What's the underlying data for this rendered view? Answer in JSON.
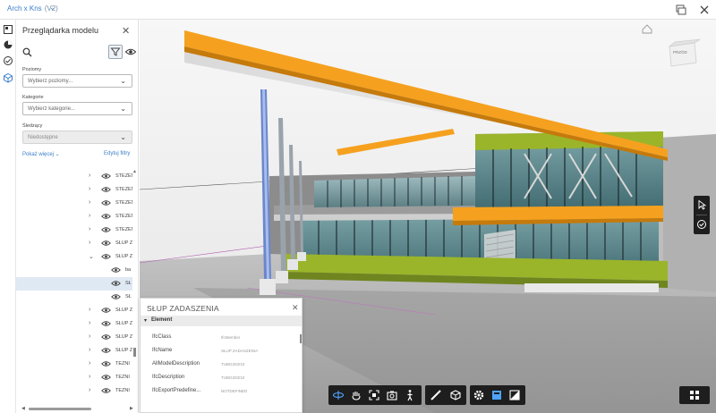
{
  "titlebar": {
    "document": "Arch x Kns",
    "version": "(V2)"
  },
  "panel": {
    "title": "Przeglądarka modelu",
    "filters": [
      {
        "label": "Poziomy",
        "value": "Wybierz poziomy...",
        "disabled": false
      },
      {
        "label": "Kategorie",
        "value": "Wybierz kategorie...",
        "disabled": false
      },
      {
        "label": "Śledzący",
        "value": "Niedostępne",
        "disabled": true
      }
    ],
    "show_more": "Pokaż więcej",
    "edit_filters": "Edytuj filtry",
    "tree": [
      {
        "label": "STEŻEN",
        "indent": 0,
        "arrow": "›"
      },
      {
        "label": "STEŻEN",
        "indent": 0,
        "arrow": "›"
      },
      {
        "label": "STEŻEN",
        "indent": 0,
        "arrow": "›"
      },
      {
        "label": "STEŻEN",
        "indent": 0,
        "arrow": "›"
      },
      {
        "label": "STEŻEN",
        "indent": 0,
        "arrow": "›"
      },
      {
        "label": "SŁUP Z",
        "indent": 0,
        "arrow": "›"
      },
      {
        "label": "SŁUP Z",
        "indent": 0,
        "arrow": "⌄"
      },
      {
        "label": "ba",
        "indent": 1,
        "arrow": ""
      },
      {
        "label": "SŁ",
        "indent": 1,
        "arrow": "",
        "selected": true
      },
      {
        "label": "SŁ",
        "indent": 1,
        "arrow": ""
      },
      {
        "label": "SŁUP Z",
        "indent": 0,
        "arrow": "›"
      },
      {
        "label": "SŁUP Z",
        "indent": 0,
        "arrow": "›"
      },
      {
        "label": "SŁUP Z",
        "indent": 0,
        "arrow": "›"
      },
      {
        "label": "SŁUP Z",
        "indent": 0,
        "arrow": "›"
      },
      {
        "label": "TEZNI",
        "indent": 0,
        "arrow": "›"
      },
      {
        "label": "TEZNI",
        "indent": 0,
        "arrow": "›"
      },
      {
        "label": "TEZNI",
        "indent": 0,
        "arrow": "›"
      }
    ]
  },
  "properties": {
    "title": "SŁUP ZADASZENIA",
    "section": "Element",
    "rows": [
      {
        "key": "IfcClass",
        "value": "IfcMember"
      },
      {
        "key": "IfcName",
        "value": "SŁUP ZADASZENIA"
      },
      {
        "key": "AllModelDescription",
        "value": "TUBG203/10"
      },
      {
        "key": "IfcDescription",
        "value": "TUBG203/10"
      },
      {
        "key": "IfcExportPredefine...",
        "value": "NOTDEFINED"
      }
    ]
  },
  "viewcube": {
    "label": "PRZÓD"
  },
  "toolbar": {
    "groups": [
      [
        "orbit-icon",
        "pan-icon",
        "fit-view-icon",
        "camera-icon",
        "walk-icon"
      ],
      [
        "measure-icon",
        "section-icon"
      ],
      [
        "settings-icon",
        "model-browser-icon",
        "properties-icon"
      ]
    ]
  },
  "colors": {
    "accent": "#3a7ec9",
    "roof_orange": "#f5a11f",
    "glass_teal": "#5f8e93",
    "floor_green": "#9ab52a",
    "toolbar_dark": "#1e1e1e"
  }
}
